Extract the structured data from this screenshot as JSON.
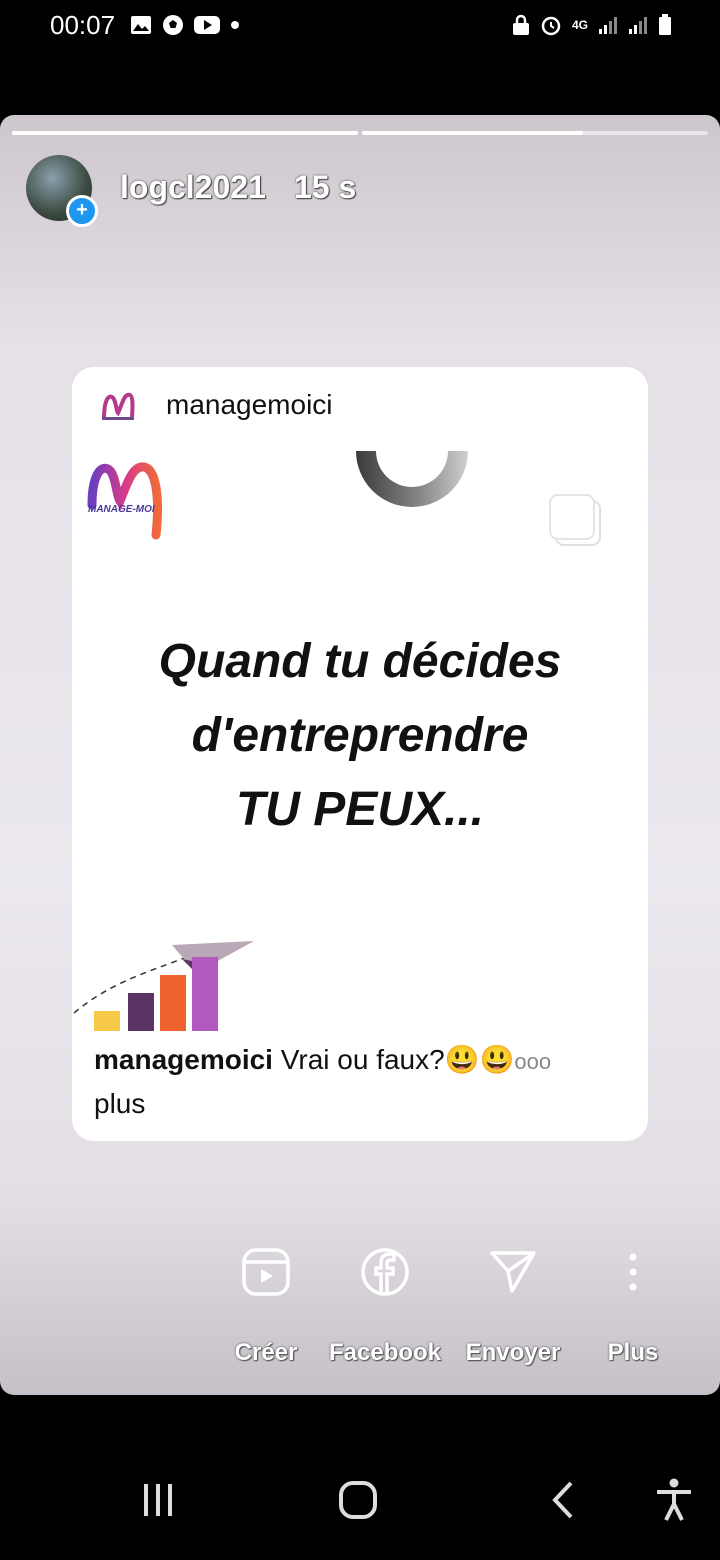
{
  "status_bar": {
    "time": "00:07",
    "left_icons": [
      "gallery-icon",
      "soccer-ball-icon",
      "youtube-icon",
      "dot-icon"
    ],
    "right_icons": [
      "lock-icon",
      "alarm-icon",
      "4g-icon",
      "signal-icon",
      "signal-icon",
      "battery-icon"
    ],
    "network": "4G"
  },
  "story": {
    "progress": [
      1.0,
      0.64
    ],
    "user": "logcl2021",
    "time_ago": "15 s"
  },
  "post": {
    "user": "managemoici",
    "brand_text": "MANAGE-MOI",
    "headline": [
      "Quand tu décides",
      "d'entreprendre",
      "TU PEUX..."
    ],
    "caption_user": "managemoici",
    "caption_text": " Vrai ou faux?😃😃",
    "caption_more": "ooo",
    "caption_more_line": "plus",
    "bar_colors": [
      "#f7c948",
      "#5b3463",
      "#f0622e",
      "#b15bbf"
    ]
  },
  "actions": [
    {
      "label": "Créer",
      "icon": "reels-icon"
    },
    {
      "label": "Facebook",
      "icon": "facebook-icon"
    },
    {
      "label": "Envoyer",
      "icon": "send-icon"
    },
    {
      "label": "Plus",
      "icon": "more-vertical-icon"
    }
  ],
  "nav": [
    "recent-apps-icon",
    "home-icon",
    "back-icon",
    "accessibility-icon"
  ]
}
